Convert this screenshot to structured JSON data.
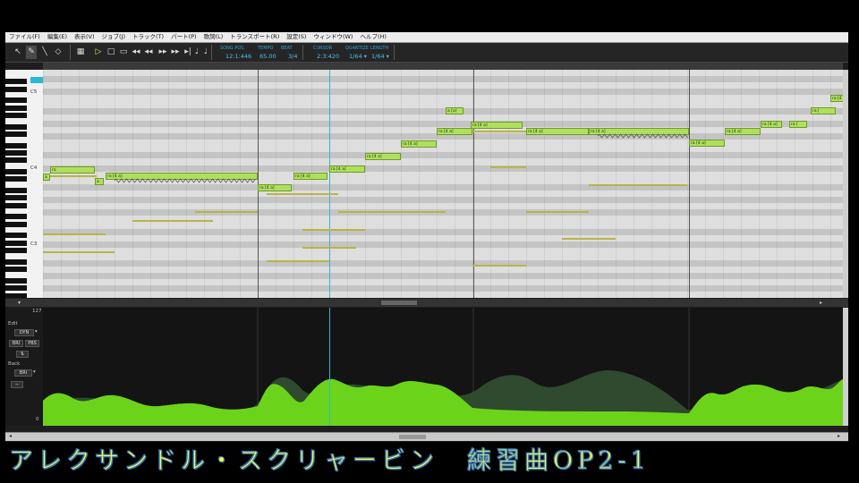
{
  "menu": [
    "ファイル(F)",
    "編集(E)",
    "表示(V)",
    "ジョブ(J)",
    "トラック(T)",
    "パート(P)",
    "歌詞(L)",
    "トランスポート(R)",
    "設定(S)",
    "ウィンドウ(W)",
    "ヘルプ(H)"
  ],
  "toolbar": {
    "tools": [
      {
        "name": "pointer-tool-icon",
        "glyph": "↖"
      },
      {
        "name": "pencil-tool-icon",
        "glyph": "✎"
      },
      {
        "name": "line-tool-icon",
        "glyph": "╲"
      },
      {
        "name": "eraser-tool-icon",
        "glyph": "◇"
      }
    ],
    "transport": [
      {
        "name": "play-icon",
        "glyph": "▷"
      },
      {
        "name": "stop-icon",
        "glyph": "□"
      },
      {
        "name": "loop-icon",
        "glyph": "▭"
      },
      {
        "name": "rewind-icon",
        "glyph": "◂◂"
      },
      {
        "name": "back-icon",
        "glyph": "◂◂"
      },
      {
        "name": "forward-icon",
        "glyph": "▸▸"
      },
      {
        "name": "fast-forward-icon",
        "glyph": "▸▸"
      },
      {
        "name": "end-icon",
        "glyph": "▸|"
      },
      {
        "name": "metronome-icon",
        "glyph": "♩"
      },
      {
        "name": "punch-icon",
        "glyph": "♩"
      }
    ],
    "song_pos_label": "SONG POS.",
    "song_pos": "12:1:446",
    "tempo_label": "TEMPO",
    "tempo": "65.00",
    "beat_label": "BEAT",
    "beat": "3/4",
    "cursor_label": "CURSOR",
    "cursor": "2:3:420",
    "quantize_label": "QUANTIZE",
    "quantize": "1/64 ▾",
    "length_label": "LENGTH",
    "length": "1/64 ▾"
  },
  "piano": {
    "octaves": [
      "C5",
      "C4",
      "C3"
    ]
  },
  "notes": [
    "a",
    "ra",
    "a",
    "ra [4 a]",
    "ra [4 a]",
    "ra [4 a]",
    "ra [4 a]",
    "ra [4 a]",
    "ra [4 a]",
    "ra [4 a]",
    "ra [4 a]",
    "ra",
    "a [a]",
    "ra [4 a]",
    "ra [4 a]",
    "ra [4 a]",
    "ra [4 a]",
    "ra [4 a]",
    "ra [4 a]",
    "ra [",
    "ra [",
    "ra [4 a]"
  ],
  "ctrl": {
    "max_value": "127",
    "min_value": "0",
    "edit_label": "Edit",
    "edit_param": "DYN",
    "buttons": [
      "BRI",
      "PBS"
    ],
    "back_label": "Back",
    "back_param": "BRI",
    "minus": "−"
  },
  "caption": "アレクサンドル・スクリャービン　練習曲OP2-1",
  "colors": {
    "note_fill": "#aee05e",
    "ctrl_curve": "#6bd41a",
    "ctrl_back": "#2f4a2f",
    "playhead": "#2ab8d8",
    "caption": "#ffff33"
  }
}
